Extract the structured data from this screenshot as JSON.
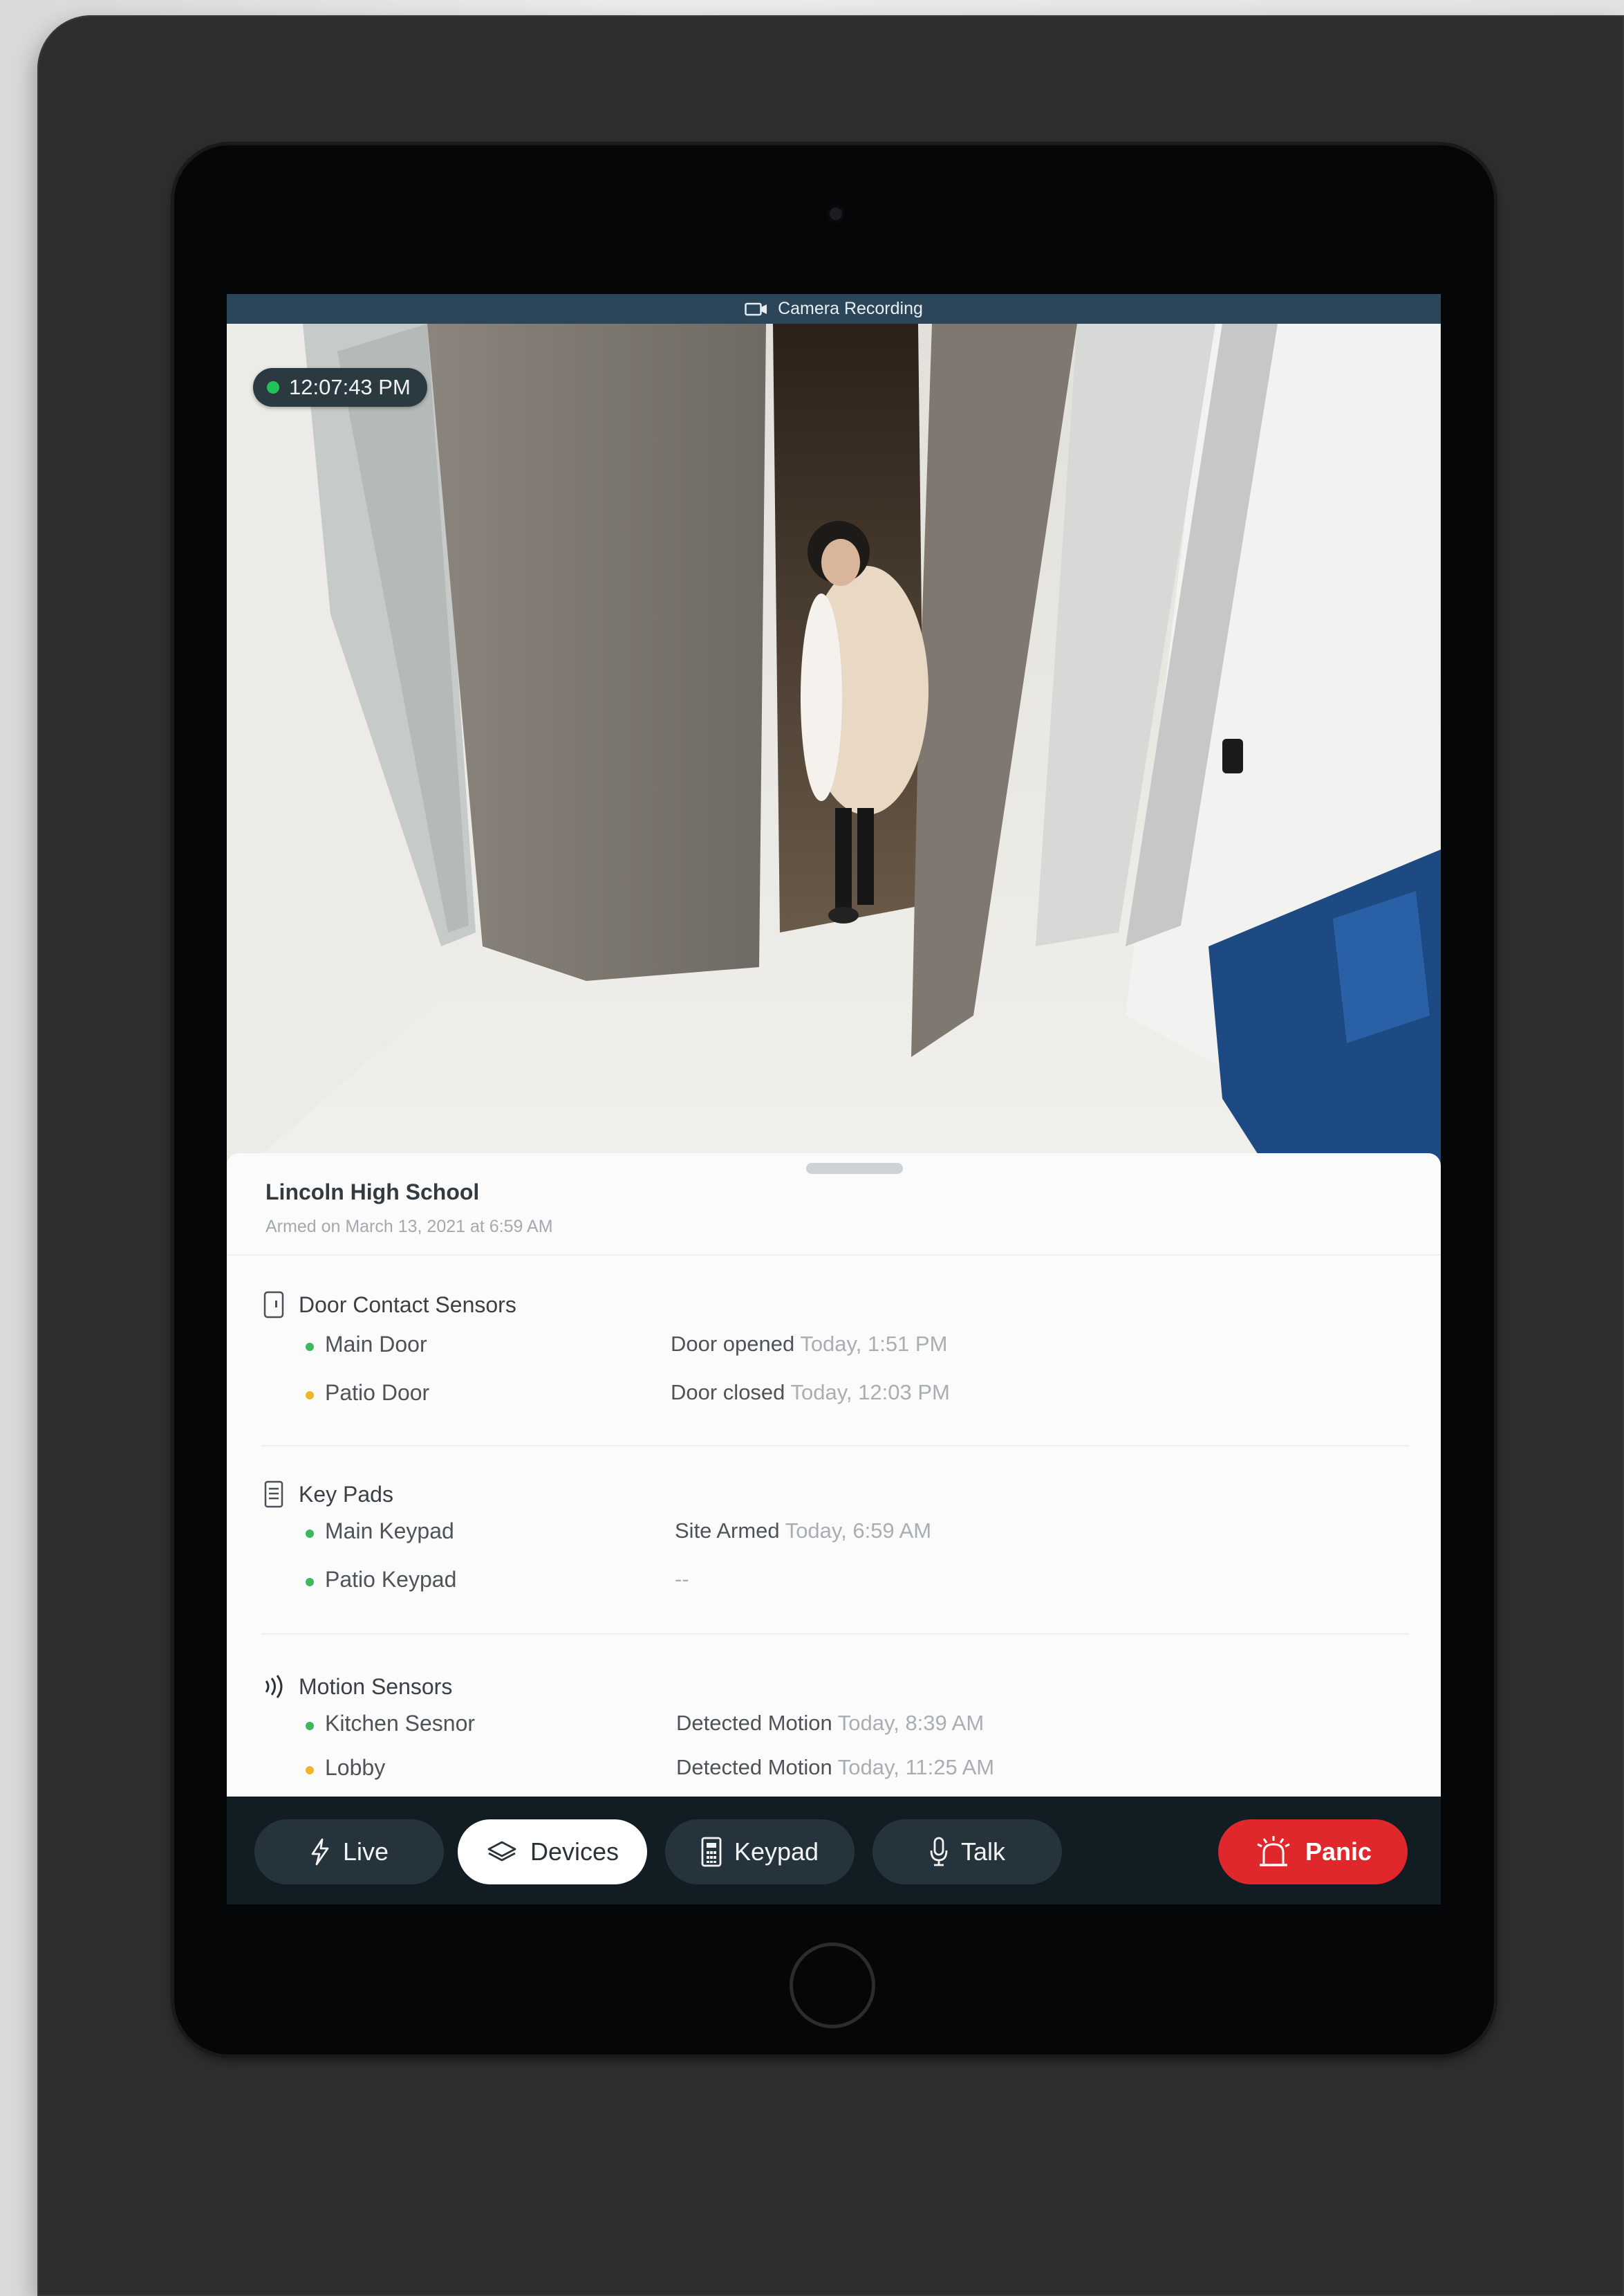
{
  "recording_bar": {
    "label": "Camera Recording",
    "icon": "video-camera-icon"
  },
  "camera": {
    "timestamp": "12:07:43 PM",
    "live_color": "#22c25a"
  },
  "site": {
    "name": "Lincoln High School",
    "armed_text": "Armed on March 13, 2021 at 6:59 AM"
  },
  "sections": [
    {
      "title": "Door Contact Sensors",
      "icon": "door-sensor-icon",
      "devices": [
        {
          "name": "Main Door",
          "status": "Door opened",
          "when": "Today, 1:51 PM",
          "dot_color": "#3cb95f"
        },
        {
          "name": "Patio Door",
          "status": "Door closed",
          "when": "Today, 12:03 PM",
          "dot_color": "#f0b429"
        }
      ]
    },
    {
      "title": "Key Pads",
      "icon": "keypad-icon",
      "devices": [
        {
          "name": "Main Keypad",
          "status": "Site Armed",
          "when": "Today, 6:59 AM",
          "dot_color": "#3cb95f"
        },
        {
          "name": "Patio Keypad",
          "status": "",
          "when": "--",
          "dot_color": "#3cb95f"
        }
      ]
    },
    {
      "title": "Motion Sensors",
      "icon": "motion-waves-icon",
      "devices": [
        {
          "name": "Kitchen Sesnor",
          "status": "Detected Motion",
          "when": "Today, 8:39 AM",
          "dot_color": "#3cb95f"
        },
        {
          "name": "Lobby",
          "status": "Detected Motion",
          "when": "Today, 11:25 AM",
          "dot_color": "#f0b429"
        }
      ]
    }
  ],
  "toolbar": {
    "live": {
      "label": "Live",
      "icon": "lightning-icon"
    },
    "devices": {
      "label": "Devices",
      "icon": "devices-layers-icon"
    },
    "keypad": {
      "label": "Keypad",
      "icon": "keypad-icon"
    },
    "talk": {
      "label": "Talk",
      "icon": "microphone-icon"
    },
    "panic": {
      "label": "Panic",
      "icon": "alarm-siren-icon",
      "color": "#e0282c"
    }
  }
}
